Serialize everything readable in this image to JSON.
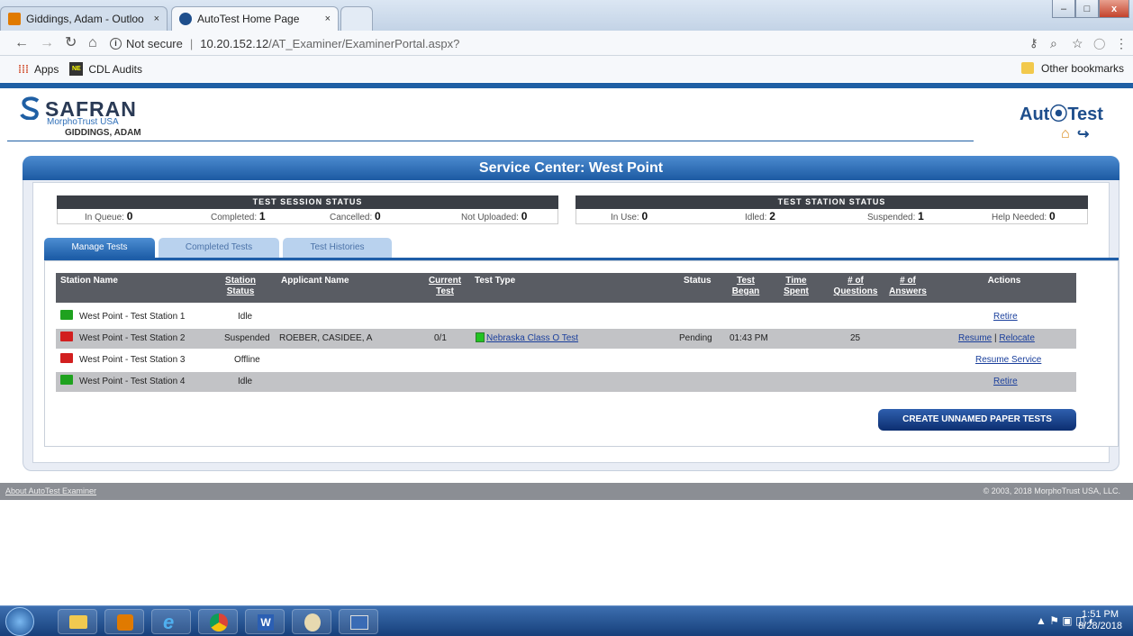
{
  "browser": {
    "tabs": [
      {
        "label": "Giddings, Adam - Outloo",
        "close": "×"
      },
      {
        "label": "AutoTest Home Page",
        "close": "×"
      }
    ],
    "window_buttons": [
      "–",
      "□",
      "x"
    ],
    "security_label": "Not secure",
    "url_host": "10.20.152.12",
    "url_path": "/AT_Examiner/ExaminerPortal.aspx?",
    "bookmarks": [
      {
        "label": "Apps",
        "icon": "apps-grid-icon"
      },
      {
        "label": "CDL Audits",
        "icon": "ne-badge-icon"
      }
    ],
    "other_bookmarks": "Other bookmarks"
  },
  "header": {
    "brand": "SAFRAN",
    "brand_sub": "MorphoTrust USA",
    "user": "GIDDINGS, ADAM",
    "product": "Aut⦿Test"
  },
  "panel": {
    "title": "Service Center: West Point"
  },
  "session_status": {
    "title": "TEST SESSION STATUS",
    "items": [
      {
        "label": "In Queue:",
        "value": "0"
      },
      {
        "label": "Completed:",
        "value": "1"
      },
      {
        "label": "Cancelled:",
        "value": "0"
      },
      {
        "label": "Not Uploaded:",
        "value": "0"
      }
    ]
  },
  "station_status": {
    "title": "TEST STATION STATUS",
    "items": [
      {
        "label": "In Use:",
        "value": "0"
      },
      {
        "label": "Idled:",
        "value": "2"
      },
      {
        "label": "Suspended:",
        "value": "1"
      },
      {
        "label": "Help Needed:",
        "value": "0"
      }
    ]
  },
  "tabs": [
    "Manage Tests",
    "Completed Tests",
    "Test Histories"
  ],
  "table": {
    "columns": [
      {
        "line1": "Station Name",
        "line2": ""
      },
      {
        "line1": "Station",
        "line2": "Status"
      },
      {
        "line1": "Applicant Name",
        "line2": ""
      },
      {
        "line1": "Current",
        "line2": "Test"
      },
      {
        "line1": "Test Type",
        "line2": ""
      },
      {
        "line1": "Status",
        "line2": ""
      },
      {
        "line1": "Test",
        "line2": "Began"
      },
      {
        "line1": "Time",
        "line2": "Spent"
      },
      {
        "line1": "# of",
        "line2": "Questions"
      },
      {
        "line1": "# of",
        "line2": "Answers"
      },
      {
        "line1": "Actions",
        "line2": ""
      }
    ],
    "rows": [
      {
        "station": "West Point - Test Station 1",
        "monitor_color": "#1fa21f",
        "station_status": "Idle",
        "applicant": "",
        "current_test": "",
        "test_type": "",
        "status": "",
        "began": "",
        "spent": "",
        "questions": "",
        "answers": "",
        "actions": [
          "Retire"
        ]
      },
      {
        "station": "West Point - Test Station 2",
        "monitor_color": "#d21f1f",
        "station_status": "Suspended",
        "applicant": "ROEBER, CASIDEE, A",
        "current_test": "0/1",
        "test_type": "Nebraska Class O Test",
        "status": "Pending",
        "began": "01:43 PM",
        "spent": "",
        "questions": "25",
        "answers": "",
        "actions": [
          "Resume",
          "Relocate"
        ]
      },
      {
        "station": "West Point - Test Station 3",
        "monitor_color": "#d21f1f",
        "station_status": "Offline",
        "applicant": "",
        "current_test": "",
        "test_type": "",
        "status": "",
        "began": "",
        "spent": "",
        "questions": "",
        "answers": "",
        "actions": [
          "Resume Service"
        ]
      },
      {
        "station": "West Point - Test Station 4",
        "monitor_color": "#1fa21f",
        "station_status": "Idle",
        "applicant": "",
        "current_test": "",
        "test_type": "",
        "status": "",
        "began": "",
        "spent": "",
        "questions": "",
        "answers": "",
        "actions": [
          "Retire"
        ]
      }
    ]
  },
  "create_button": "CREATE UNNAMED PAPER TESTS",
  "footer": {
    "left": "About AutoTest Examiner",
    "right": "© 2003, 2018 MorphoTrust USA, LLC."
  },
  "taskbar": {
    "apps": [
      "start-orb-icon",
      "file-explorer-icon",
      "outlook-icon",
      "internet-explorer-icon",
      "chrome-icon",
      "word-icon",
      "paint-icon",
      "app-icon"
    ],
    "time": "1:51 PM",
    "date": "8/28/2018"
  },
  "colors": {
    "accent": "#1f5fa4",
    "idle_monitor": "#1fa21f",
    "offline_monitor": "#d21f1f"
  }
}
